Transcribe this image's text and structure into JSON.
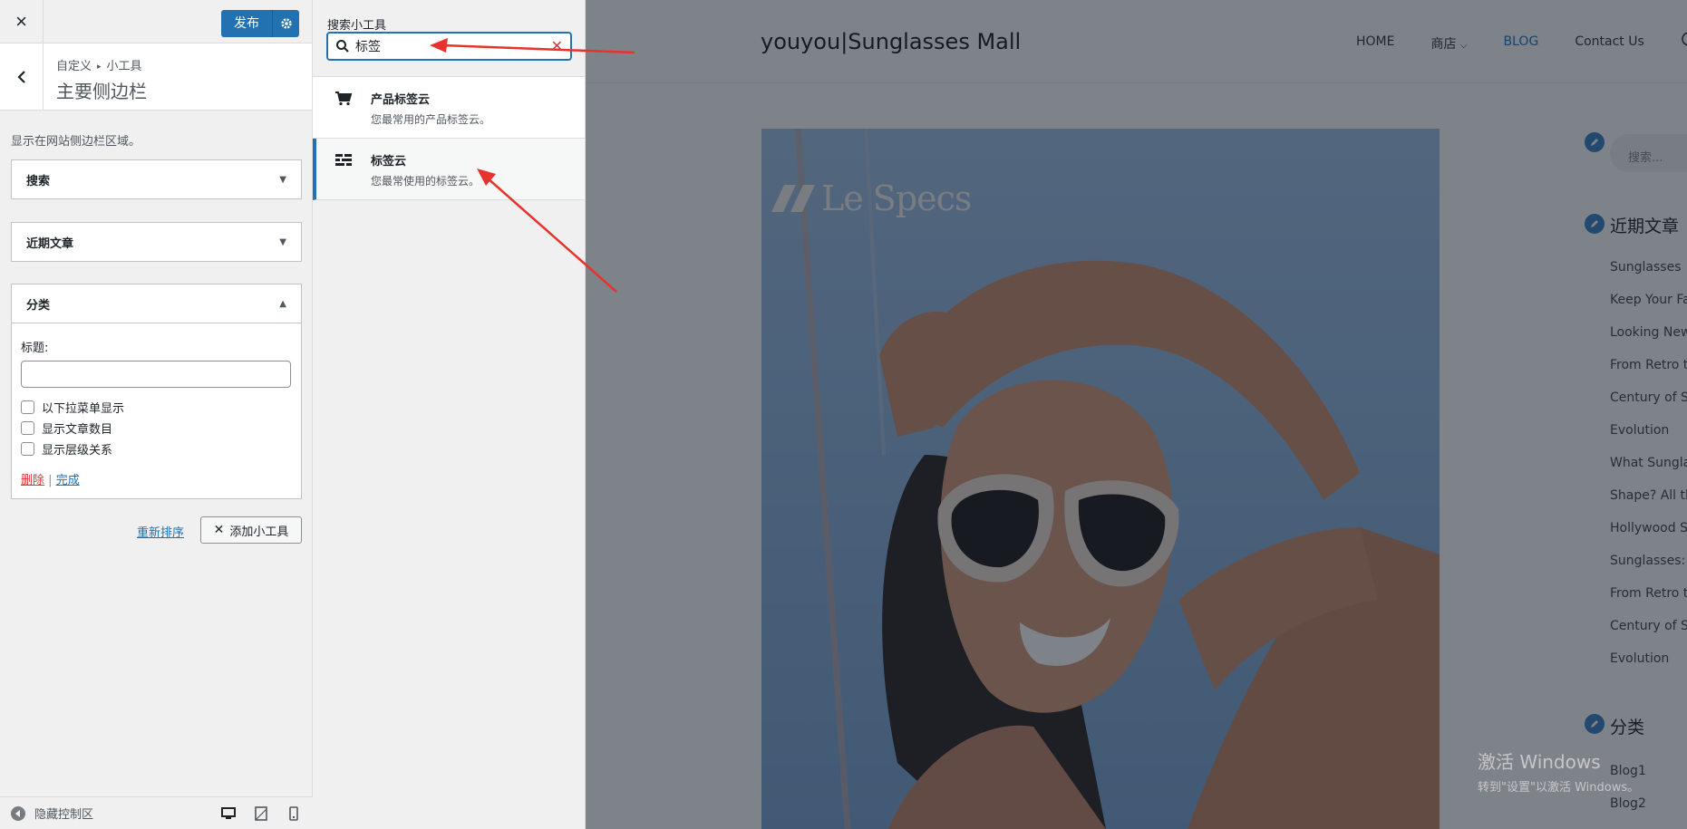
{
  "customizer": {
    "close_icon": "×",
    "publish_label": "发布",
    "breadcrumb_root": "自定义",
    "breadcrumb_current": "小工具",
    "section_title": "主要侧边栏",
    "area_description": "显示在网站侧边栏区域。",
    "widgets": [
      {
        "title": "搜索",
        "state": "collapsed"
      },
      {
        "title": "近期文章",
        "state": "collapsed"
      },
      {
        "title": "分类",
        "state": "expanded"
      }
    ],
    "category_form": {
      "title_label": "标题:",
      "title_value": "",
      "options": [
        "以下拉菜单显示",
        "显示文章数目",
        "显示层级关系"
      ],
      "delete_label": "删除",
      "separator": "|",
      "done_label": "完成"
    },
    "reorder_label": "重新排序",
    "add_widget_label": "添加小工具",
    "footer_toggle_label": "隐藏控制区"
  },
  "available_widgets": {
    "search_label": "搜索小工具",
    "search_value": "标签",
    "results": [
      {
        "name": "产品标签云",
        "description": "您最常用的产品标签云。",
        "icon": "cart-icon",
        "selected": false
      },
      {
        "name": "标签云",
        "description": "您最常使用的标签云。",
        "icon": "tag-cloud-icon",
        "selected": true
      }
    ]
  },
  "preview": {
    "site_title": "youyou|Sunglasses Mall",
    "nav": [
      "HOME",
      "商店",
      "BLOG",
      "Contact Us"
    ],
    "nav_current": "BLOG",
    "hero_brand": "Le Specs",
    "sidebar_search_placeholder": "搜索...",
    "recent_posts_heading": "近期文章",
    "recent_posts": [
      "Sunglasses",
      "Keep Your Fa",
      "Looking New",
      "From Retro t",
      "Century of S",
      "Evolution",
      "What Sungla",
      "Shape? All th",
      "Hollywood S",
      "Sunglasses:",
      "From Retro t",
      "Century of S",
      "Evolution"
    ],
    "categories_heading": "分类",
    "categories": [
      "Blog1",
      "Blog2"
    ]
  },
  "watermark": {
    "title": "激活 Windows",
    "subtitle": "转到\"设置\"以激活 Windows。"
  },
  "colors": {
    "accent": "#2271b1",
    "annotation": "#e8322c",
    "overlay": "#141c28"
  }
}
